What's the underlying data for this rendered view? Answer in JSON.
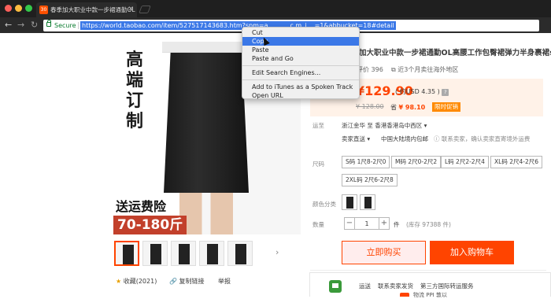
{
  "browser": {
    "tab_favicon": "30",
    "tab_title": "春季加大职业中款一步裙通勤OL",
    "tab_close": "✕",
    "secure_label": "Secure",
    "url": "https://world.taobao.com/item/527517143683.htm?spm=a...........c.m_i....=1&abbucket=18#detail"
  },
  "context_menu": {
    "items": [
      "Cut",
      "Copy",
      "Paste",
      "Paste and Go",
      "Edit Search Engines...",
      "Add to iTunes as a Spoken Track",
      "Open URL"
    ],
    "highlighted": "Copy"
  },
  "product_image": {
    "vertical_title": "高端订制",
    "badge_line1": "送运费险",
    "badge_line2": "70-180斤"
  },
  "actions": {
    "favorite": "收藏(2021)",
    "share": "复制链接",
    "report": "举报"
  },
  "product": {
    "title": "事季加大职业中款一步裙通勤OL高腰工作包臀裙弹力半身裹裙skirt",
    "reviews_label": "累计评价",
    "reviews_count": "396",
    "sales": "近3个月卖往海外地区",
    "price": "¥129.90",
    "usd": "( 约USD 4.35 )",
    "usd_help": "?",
    "old_price": "¥ 128.00",
    "save_prefix": "省",
    "save_amount": "¥ 98.10",
    "promo": "限时促销"
  },
  "shipping": {
    "label": "运至",
    "destination": "浙江金华 至  香港香港岛中西区 ▾",
    "seller_label": "卖家直送 ▾",
    "seller_value": "中国大陆境内包邮",
    "seller_note": "ⓘ 联系卖家，确认卖家直寄境外运费"
  },
  "sizes": {
    "label": "尺码",
    "options": [
      "S码 1尺8-2尺0",
      "M码 2尺0-2尺2",
      "L码 2尺2-2尺4",
      "XL码 2尺4-2尺6",
      "2XL码 2尺6-2尺8"
    ]
  },
  "color": {
    "label": "颜色分类"
  },
  "quantity": {
    "label": "数量",
    "minus": "−",
    "plus": "+",
    "value": "1",
    "unit": "件",
    "stock": "(库存 97388 件)"
  },
  "buttons": {
    "buy_now": "立即购买",
    "add_cart": "加入购物车"
  },
  "shipping_info": {
    "title": "运送",
    "line1": "联系卖家发货",
    "line2": "第三方国际转运服务",
    "sub": "物流 PPI 敦以"
  },
  "colors": {
    "accent": "#ff4400",
    "price_bg": "#fff2e8",
    "url_highlight": "#3b78e7"
  }
}
